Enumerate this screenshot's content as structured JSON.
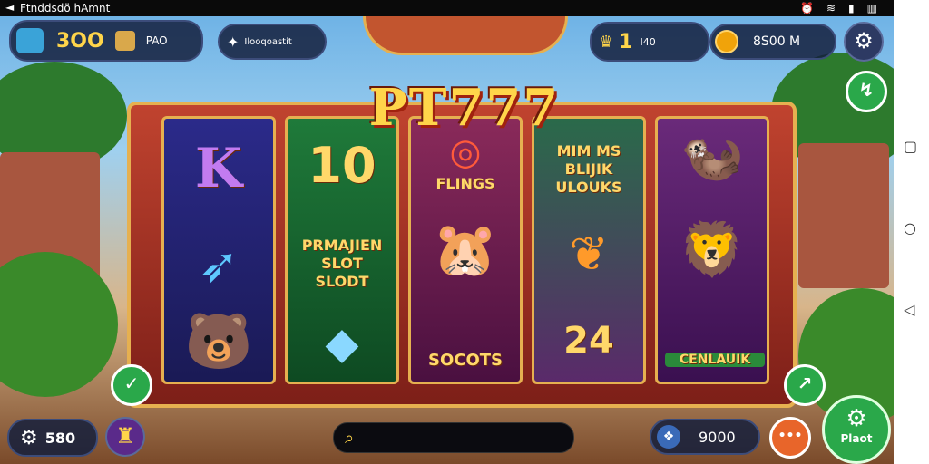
{
  "status_bar": {
    "title": "Ftnddsdö hAmnt",
    "icons": [
      "alarm-icon",
      "wifi-icon",
      "battery-icon",
      "signal-icon"
    ]
  },
  "top_bar": {
    "coins_value": "3OO",
    "gem_label": "PAO",
    "unlock_label": "Ilooqoastit",
    "level_number": "1",
    "level_tag": "I40",
    "balance_value": "8S00 M"
  },
  "logo_text": "PT777",
  "reels": [
    {
      "symbols": [
        "K",
        "arrow",
        "bear"
      ]
    },
    {
      "symbols": [
        "10",
        "PRMAJIEN SLOT SLODT",
        "gem-leaf"
      ]
    },
    {
      "symbols": [
        "FLINGS",
        "bear-face",
        "SOCOTS"
      ]
    },
    {
      "symbols": [
        "MIM MS BLIJIK ULOUKS",
        "fire-leaf",
        "24"
      ]
    },
    {
      "symbols": [
        "otter",
        "lion",
        "CENLAUIK"
      ]
    }
  ],
  "bottom_bar": {
    "bet_value": "580",
    "search_placeholder": "",
    "credit_value": "9000",
    "extra_label": "•••",
    "play_label": "Plaot"
  },
  "colors": {
    "accent": "#f0a30a",
    "green": "#2aa84a",
    "frame": "#c0432f",
    "gold": "#e6b050"
  }
}
